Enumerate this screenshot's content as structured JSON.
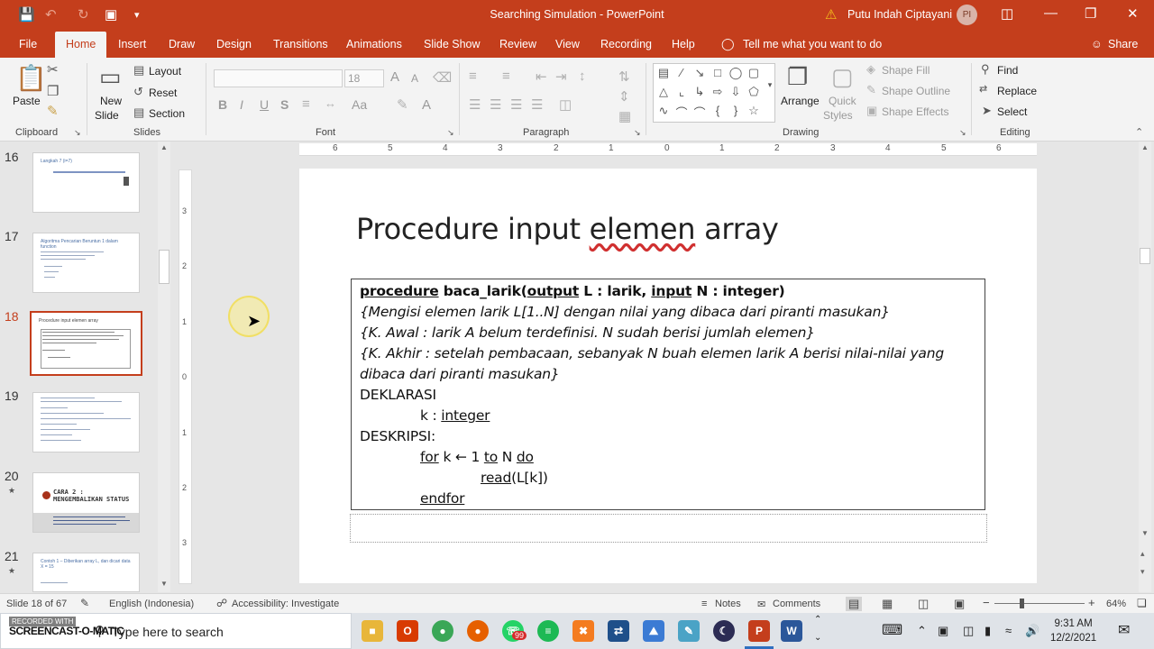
{
  "window": {
    "title": "Searching Simulation - PowerPoint",
    "user_name": "Putu Indah Ciptayani",
    "user_initials": "PI"
  },
  "tabs": [
    "File",
    "Home",
    "Insert",
    "Draw",
    "Design",
    "Transitions",
    "Animations",
    "Slide Show",
    "Review",
    "View",
    "Recording",
    "Help"
  ],
  "active_tab": "Home",
  "tell_me": "Tell me what you want to do",
  "share_label": "Share",
  "ribbon": {
    "clipboard": {
      "paste": "Paste",
      "label": "Clipboard"
    },
    "slides": {
      "new_slide_1": "New",
      "new_slide_2": "Slide",
      "layout": "Layout",
      "reset": "Reset",
      "section": "Section",
      "label": "Slides"
    },
    "font": {
      "font_size": "18",
      "label": "Font",
      "bold": "B",
      "italic": "I",
      "underline": "U",
      "strike": "S",
      "case": "Aa",
      "color": "A",
      "grow": "A",
      "shrink": "A"
    },
    "paragraph": {
      "label": "Paragraph"
    },
    "drawing": {
      "arrange": "Arrange",
      "quick_styles_1": "Quick",
      "quick_styles_2": "Styles",
      "shape_fill": "Shape Fill",
      "shape_outline": "Shape Outline",
      "shape_effects": "Shape Effects",
      "label": "Drawing"
    },
    "editing": {
      "find": "Find",
      "replace": "Replace",
      "select": "Select",
      "label": "Editing"
    }
  },
  "ruler": {
    "h": [
      "6",
      "5",
      "4",
      "3",
      "2",
      "1",
      "0",
      "1",
      "2",
      "3",
      "4",
      "5",
      "6"
    ],
    "v": [
      "3",
      "2",
      "1",
      "0",
      "1",
      "2",
      "3"
    ]
  },
  "thumbnails": [
    {
      "num": "16",
      "title": "Langkah 7 (i=7)",
      "star": ""
    },
    {
      "num": "17",
      "title": "Algoritma Pencarian Beruntun 1 dalam function",
      "star": ""
    },
    {
      "num": "18",
      "title": "Procedure input elemen array",
      "star": ""
    },
    {
      "num": "19",
      "title": "",
      "star": ""
    },
    {
      "num": "20",
      "title": "CARA 2 : MENGEMBALIKAN STATUS",
      "star": "★"
    },
    {
      "num": "21",
      "title": "Contoh 1 – Diberikan array L, dan dicari data X = 15",
      "star": "★"
    }
  ],
  "slide": {
    "title_pre": "Procedure input ",
    "title_squiggle": "elemen",
    "title_post": " array",
    "code": {
      "l1_kw": "procedure",
      "l1_a": " baca_larik(",
      "l1_out": "output",
      "l1_b": " L : larik, ",
      "l1_in": "input",
      "l1_c": " N : integer)",
      "l2": "{Mengisi elemen larik L[1..N] dengan nilai yang dibaca dari piranti masukan}",
      "l3": "{K. Awal  : larik A belum terdefinisi. N sudah berisi jumlah elemen}",
      "l4": "{K. Akhir : setelah pembacaan, sebanyak N buah elemen larik A berisi nilai-nilai yang",
      "l5": "dibaca dari piranti masukan}",
      "l6": "DEKLARASI",
      "l7_a": "k : ",
      "l7_b": "integer",
      "l8": "DESKRIPSI:",
      "l9_for": "for",
      "l9_a": " k ← 1 ",
      "l9_to": "to",
      "l9_b": " N ",
      "l9_do": "do",
      "l10": "read",
      "l10_b": "(L[k])",
      "l11": "endfor"
    }
  },
  "status": {
    "slide_of": "Slide 18 of 67",
    "language": "English (Indonesia)",
    "accessibility": "Accessibility: Investigate",
    "notes": "Notes",
    "comments": "Comments",
    "zoom": "64%"
  },
  "taskbar": {
    "search": "Type here to search",
    "time": "9:31 AM",
    "date": "12/2/2021",
    "badge": "99"
  },
  "watermark": {
    "top": "RECORDED WITH",
    "bottom": "SCREENCAST-O-MATIC"
  }
}
